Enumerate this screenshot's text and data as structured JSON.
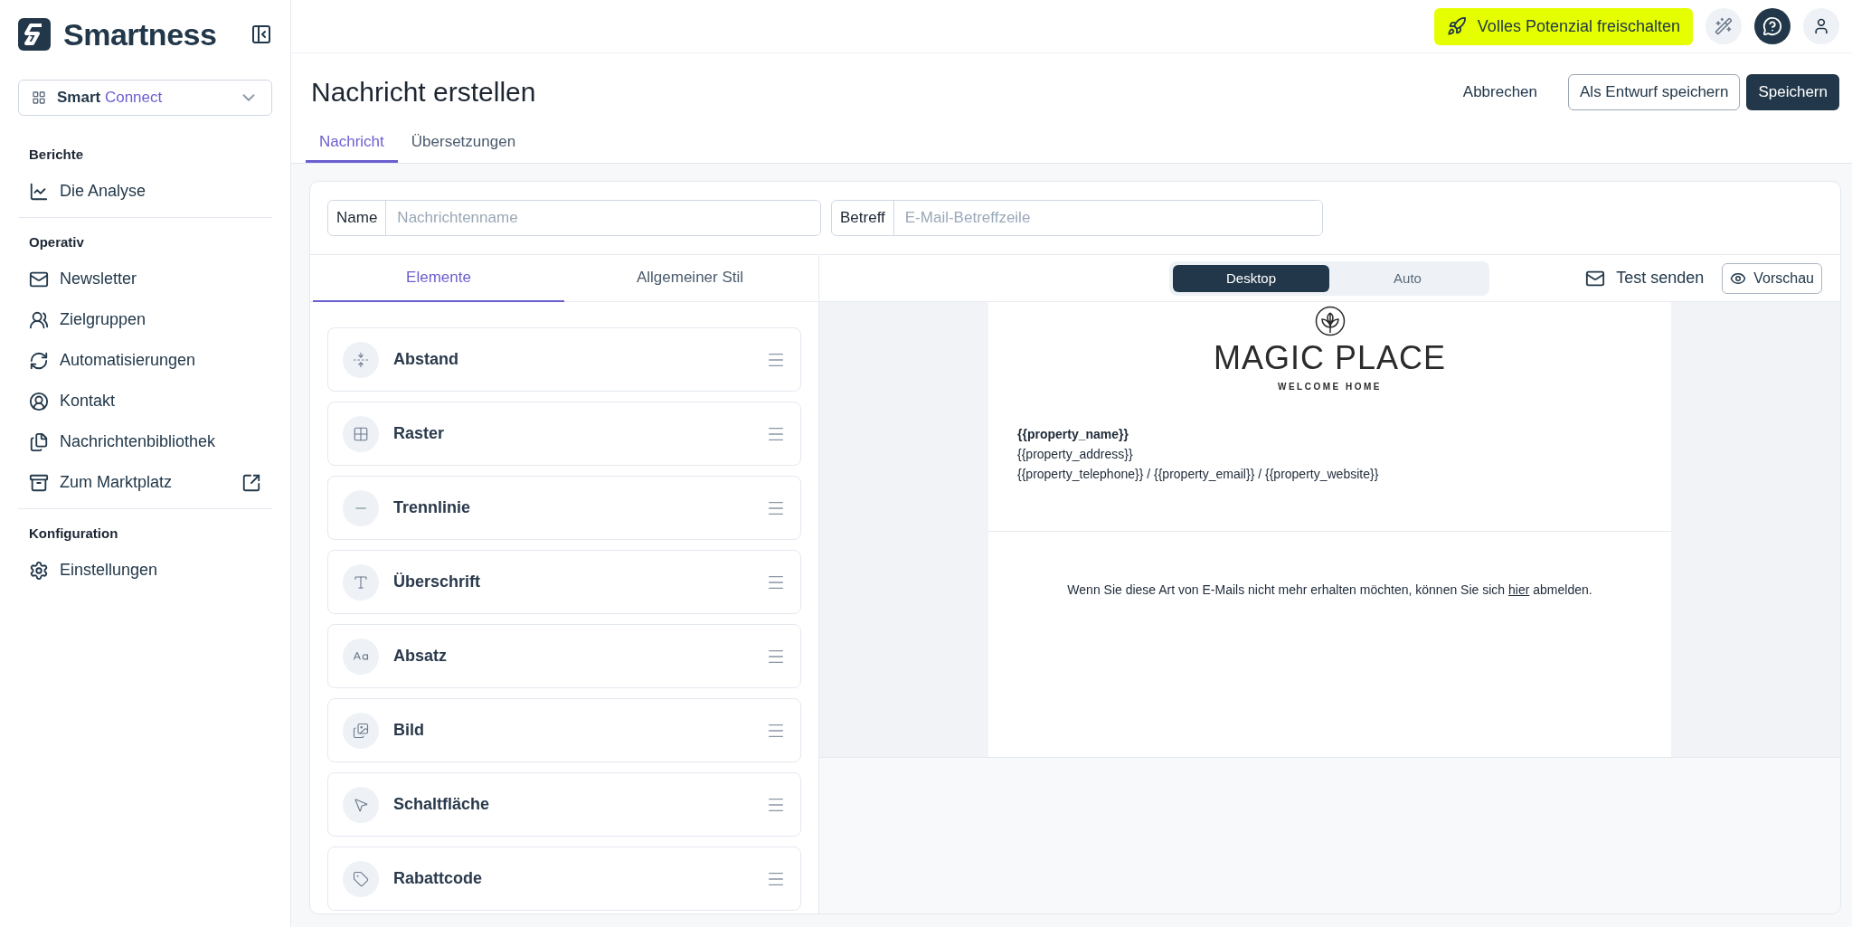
{
  "sidebar": {
    "brand": "Smartness",
    "product": {
      "brand": "Smart",
      "name": "Connect"
    },
    "sections": [
      {
        "title": "Berichte",
        "items": [
          {
            "label": "Die Analyse",
            "external": false
          }
        ]
      },
      {
        "title": "Operativ",
        "items": [
          {
            "label": "Newsletter",
            "external": false
          },
          {
            "label": "Zielgruppen",
            "external": false
          },
          {
            "label": "Automatisierungen",
            "external": false
          },
          {
            "label": "Kontakt",
            "external": false
          },
          {
            "label": "Nachrichtenbibliothek",
            "external": false
          },
          {
            "label": "Zum Marktplatz",
            "external": true
          }
        ]
      },
      {
        "title": "Konfiguration",
        "items": [
          {
            "label": "Einstellungen",
            "external": false
          }
        ]
      }
    ]
  },
  "topbar": {
    "upgrade_button": "Volles Potenzial freischalten"
  },
  "page": {
    "title": "Nachricht erstellen",
    "actions": {
      "cancel": "Abbrechen",
      "draft": "Als Entwurf speichern",
      "save": "Speichern"
    },
    "tabs": [
      {
        "label": "Nachricht",
        "selected": true
      },
      {
        "label": "Übersetzungen",
        "selected": false
      }
    ]
  },
  "fields": [
    {
      "label": "Name",
      "placeholder": "Nachrichtenname"
    },
    {
      "label": "Betreff",
      "placeholder": "E-Mail-Betreffzeile"
    }
  ],
  "editor_tabs": [
    {
      "label": "Elemente",
      "selected": true
    },
    {
      "label": "Allgemeiner Stil",
      "selected": false
    }
  ],
  "elements": [
    "Abstand",
    "Raster",
    "Trennlinie",
    "Überschrift",
    "Absatz",
    "Bild",
    "Schaltfläche",
    "Rabattcode"
  ],
  "preview": {
    "modes": [
      {
        "label": "Desktop",
        "selected": true
      },
      {
        "label": "Auto",
        "selected": false
      }
    ],
    "test_send": "Test senden",
    "preview_button": "Vorschau",
    "email": {
      "logo_title": "MAGIC PLACE",
      "logo_tagline": "WELCOME HOME",
      "property_name": "{{property_name}}",
      "address": "{{property_address}}",
      "contact": "{{property_telephone}} / {{property_email}} / {{property_website}}",
      "footer": {
        "before": "Wenn Sie diese Art von E-Mails nicht mehr erhalten möchten, können Sie sich ",
        "link": "hier",
        "after": " abmelden."
      }
    }
  }
}
